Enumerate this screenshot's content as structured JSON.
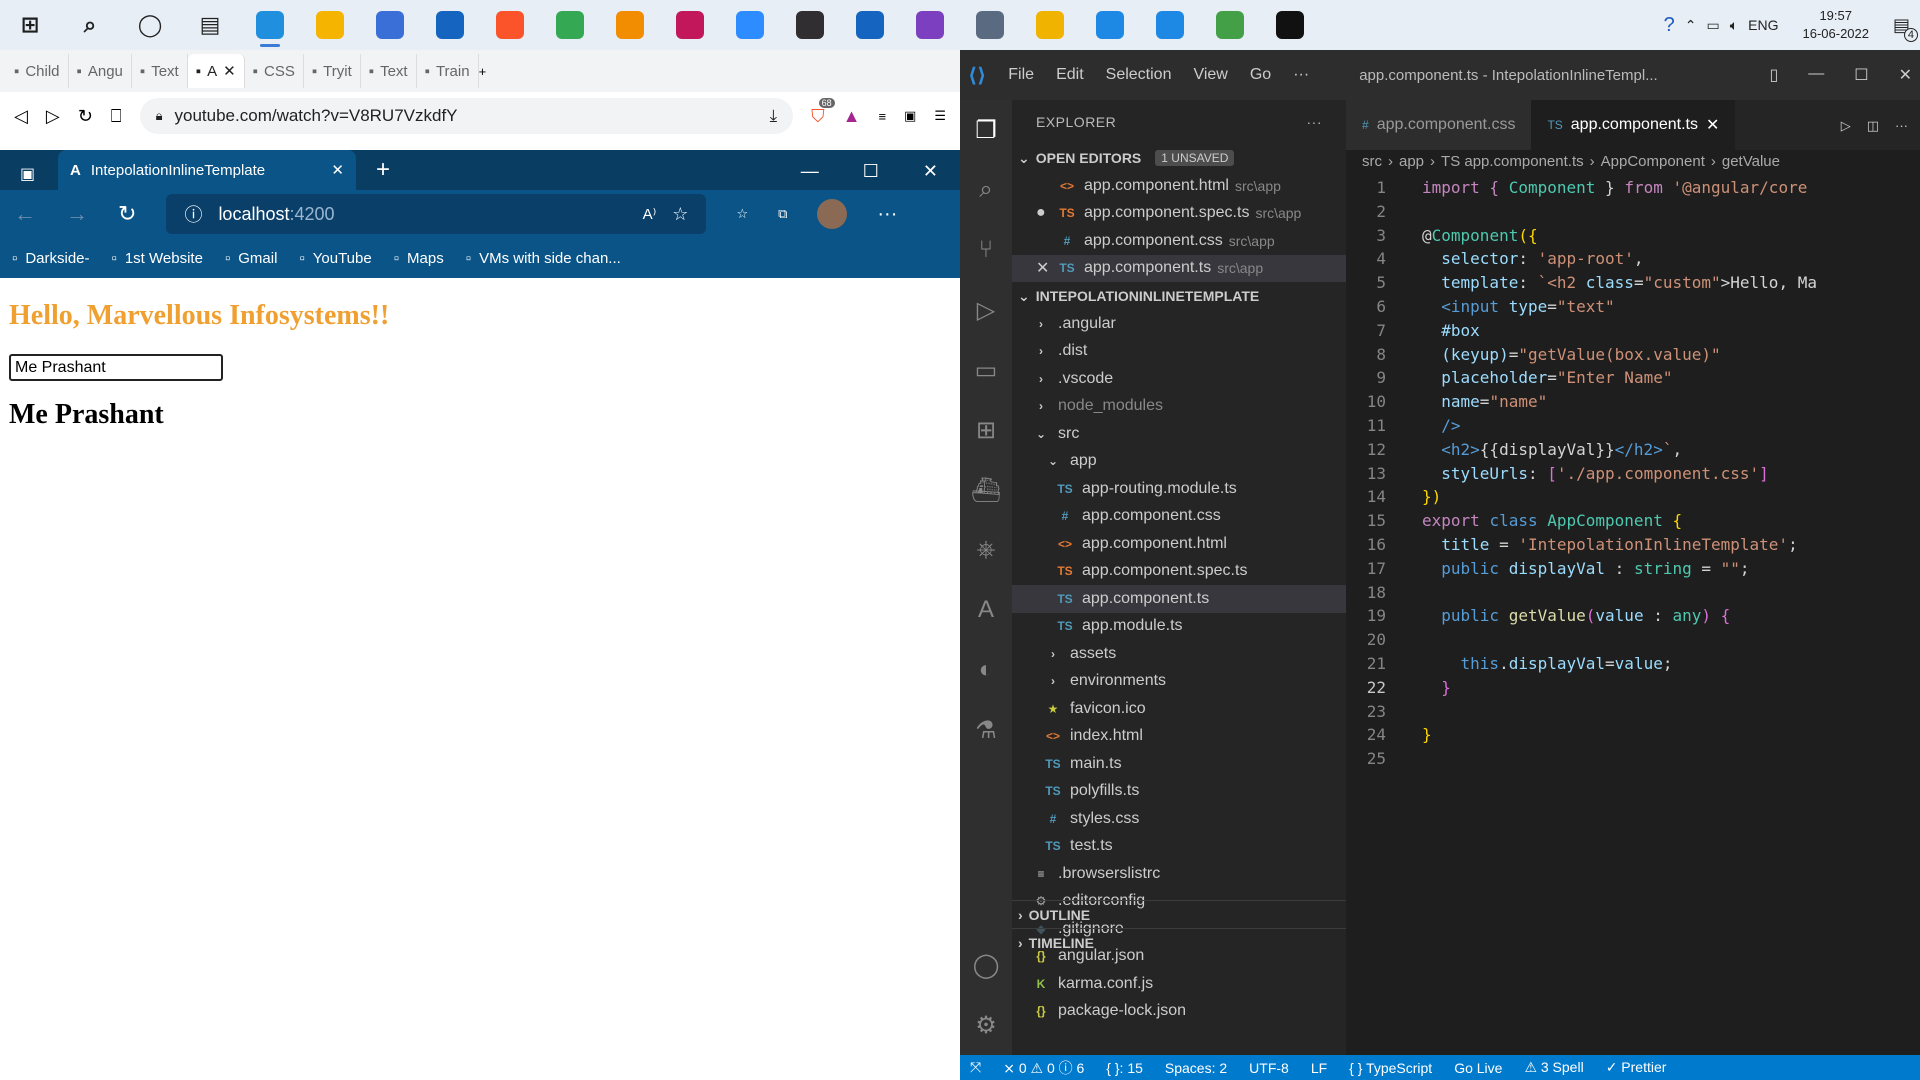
{
  "taskbar": {
    "apps": [
      {
        "name": "windows-start",
        "color": "#1e1e1e"
      },
      {
        "name": "search",
        "color": "#222"
      },
      {
        "name": "cortana",
        "color": "#222"
      },
      {
        "name": "task-view",
        "color": "#222"
      },
      {
        "name": "edge",
        "color": "#1f8fde"
      },
      {
        "name": "file-explorer",
        "color": "#f4b400"
      },
      {
        "name": "store",
        "color": "#3a6fd8"
      },
      {
        "name": "mail",
        "color": "#1565c0"
      },
      {
        "name": "brave",
        "color": "#fb542b"
      },
      {
        "name": "chrome",
        "color": "#34a853"
      },
      {
        "name": "vlc",
        "color": "#f28c00"
      },
      {
        "name": "intellij",
        "color": "#c2185b"
      },
      {
        "name": "zoom",
        "color": "#2d8cff"
      },
      {
        "name": "obs",
        "color": "#302e31"
      },
      {
        "name": "typora",
        "color": "#1565c0"
      },
      {
        "name": "visual-studio",
        "color": "#7b3fbf"
      },
      {
        "name": "settings-app",
        "color": "#5a6a80"
      },
      {
        "name": "sticky",
        "color": "#f0b400"
      },
      {
        "name": "vscode",
        "color": "#1e88e5"
      },
      {
        "name": "vscode-insiders",
        "color": "#1e88e5"
      },
      {
        "name": "atom",
        "color": "#43a047"
      },
      {
        "name": "terminal",
        "color": "#111"
      }
    ],
    "lang": "ENG",
    "time": "19:57",
    "date": "16-06-2022",
    "notif_count": "4"
  },
  "brave": {
    "tabs": [
      "Child",
      "Angu",
      "Text",
      "A",
      "CSS",
      "Tryit",
      "Text",
      "Train"
    ],
    "url": "youtube.com/watch?v=V8RU7VzkdfY",
    "badge": "68"
  },
  "edge": {
    "tab_title": "IntepolationInlineTemplate",
    "url_host": "localhost",
    "url_port": ":4200",
    "favorites": [
      "Darkside-",
      "1st Website",
      "Gmail",
      "YouTube",
      "Maps",
      "VMs with side chan..."
    ],
    "page": {
      "heading": "Hello, Marvellous Infosystems!!",
      "input_value": "Me Prashant",
      "output": "Me Prashant"
    }
  },
  "vscode": {
    "menu": [
      "File",
      "Edit",
      "Selection",
      "View",
      "Go",
      "···"
    ],
    "window_title": "app.component.ts - IntepolationInlineTempl...",
    "explorer_label": "EXPLORER",
    "open_editors_label": "OPEN EDITORS",
    "unsaved_badge": "1 UNSAVED",
    "open_editors": [
      {
        "icon": "<>",
        "icon_color": "#e37933",
        "name": "app.component.html",
        "path": "src\\app",
        "mark": ""
      },
      {
        "icon": "TS",
        "icon_color": "#e37933",
        "name": "app.component.spec.ts",
        "path": "src\\app",
        "mark": "●"
      },
      {
        "icon": "#",
        "icon_color": "#519aba",
        "name": "app.component.css",
        "path": "src\\app",
        "mark": ""
      },
      {
        "icon": "TS",
        "icon_color": "#519aba",
        "name": "app.component.ts",
        "path": "src\\app",
        "mark": "✕"
      }
    ],
    "project_label": "INTEPOLATIONINLINETEMPLATE",
    "tree": [
      {
        "d": 1,
        "icon": "›",
        "color": "#ccc",
        "name": ".angular"
      },
      {
        "d": 1,
        "icon": "›",
        "color": "#ccc",
        "name": ".dist"
      },
      {
        "d": 1,
        "icon": "›",
        "color": "#ccc",
        "name": ".vscode"
      },
      {
        "d": 1,
        "icon": "›",
        "color": "#ccc",
        "name": "node_modules",
        "dim": true
      },
      {
        "d": 1,
        "icon": "⌄",
        "color": "#ccc",
        "name": "src"
      },
      {
        "d": 2,
        "icon": "⌄",
        "color": "#ccc",
        "name": "app"
      },
      {
        "d": 3,
        "icon": "TS",
        "color": "#519aba",
        "name": "app-routing.module.ts"
      },
      {
        "d": 3,
        "icon": "#",
        "color": "#519aba",
        "name": "app.component.css"
      },
      {
        "d": 3,
        "icon": "<>",
        "color": "#e37933",
        "name": "app.component.html"
      },
      {
        "d": 3,
        "icon": "TS",
        "color": "#e37933",
        "name": "app.component.spec.ts"
      },
      {
        "d": 3,
        "icon": "TS",
        "color": "#519aba",
        "name": "app.component.ts",
        "sel": true
      },
      {
        "d": 3,
        "icon": "TS",
        "color": "#519aba",
        "name": "app.module.ts"
      },
      {
        "d": 2,
        "icon": "›",
        "color": "#ccc",
        "name": "assets"
      },
      {
        "d": 2,
        "icon": "›",
        "color": "#ccc",
        "name": "environments"
      },
      {
        "d": 2,
        "icon": "★",
        "color": "#cbcb41",
        "name": "favicon.ico"
      },
      {
        "d": 2,
        "icon": "<>",
        "color": "#e37933",
        "name": "index.html"
      },
      {
        "d": 2,
        "icon": "TS",
        "color": "#519aba",
        "name": "main.ts"
      },
      {
        "d": 2,
        "icon": "TS",
        "color": "#519aba",
        "name": "polyfills.ts"
      },
      {
        "d": 2,
        "icon": "#",
        "color": "#519aba",
        "name": "styles.css"
      },
      {
        "d": 2,
        "icon": "TS",
        "color": "#519aba",
        "name": "test.ts"
      },
      {
        "d": 1,
        "icon": "≡",
        "color": "#ccc",
        "name": ".browserslistrc"
      },
      {
        "d": 1,
        "icon": "⚙",
        "color": "#aaa",
        "name": ".editorconfig"
      },
      {
        "d": 1,
        "icon": "◆",
        "color": "#41535b",
        "name": ".gitignore"
      },
      {
        "d": 1,
        "icon": "{}",
        "color": "#cbcb41",
        "name": "angular.json"
      },
      {
        "d": 1,
        "icon": "K",
        "color": "#8dc149",
        "name": "karma.conf.js"
      },
      {
        "d": 1,
        "icon": "{}",
        "color": "#cbcb41",
        "name": "package-lock.json"
      }
    ],
    "outline_label": "OUTLINE",
    "timeline_label": "TIMELINE",
    "tabs": [
      {
        "icon": "#",
        "name": "app.component.css",
        "active": false
      },
      {
        "icon": "TS",
        "name": "app.component.ts",
        "active": true
      }
    ],
    "breadcrumbs": [
      "src",
      "app",
      "TS app.component.ts",
      "AppComponent",
      "getValue"
    ],
    "code": [
      [
        [
          "import { ",
          "#c586c0"
        ],
        [
          "Component",
          "#4ec9b0"
        ],
        [
          " } ",
          "#d4d4d4"
        ],
        [
          "from",
          "#c586c0"
        ],
        [
          " '@angular/core",
          "#ce9178"
        ]
      ],
      [],
      [
        [
          "@",
          "#d4d4d4"
        ],
        [
          "Component",
          "#4ec9b0"
        ],
        [
          "({",
          "#ffd700"
        ]
      ],
      [
        [
          "  selector",
          "#9cdcfe"
        ],
        [
          ": ",
          "#d4d4d4"
        ],
        [
          "'app-root'",
          "#ce9178"
        ],
        [
          ",",
          "#d4d4d4"
        ]
      ],
      [
        [
          "  template",
          "#9cdcfe"
        ],
        [
          ": ",
          "#d4d4d4"
        ],
        [
          "`<h2 ",
          "#ce9178"
        ],
        [
          "class",
          "#9cdcfe"
        ],
        [
          "=",
          "#d4d4d4"
        ],
        [
          "\"custom\"",
          "#ce9178"
        ],
        [
          ">Hello, Ma",
          "#d4d4d4"
        ]
      ],
      [
        [
          "  <input ",
          "#569cd6"
        ],
        [
          "type",
          "#9cdcfe"
        ],
        [
          "=",
          "#d4d4d4"
        ],
        [
          "\"text\"",
          "#ce9178"
        ]
      ],
      [
        [
          "  #box",
          "#9cdcfe"
        ]
      ],
      [
        [
          "  (keyup)",
          "#9cdcfe"
        ],
        [
          "=",
          "#d4d4d4"
        ],
        [
          "\"getValue(box.value)\"",
          "#ce9178"
        ]
      ],
      [
        [
          "  placeholder",
          "#9cdcfe"
        ],
        [
          "=",
          "#d4d4d4"
        ],
        [
          "\"Enter Name\"",
          "#ce9178"
        ]
      ],
      [
        [
          "  name",
          "#9cdcfe"
        ],
        [
          "=",
          "#d4d4d4"
        ],
        [
          "\"name\"",
          "#ce9178"
        ]
      ],
      [
        [
          "  />",
          "#569cd6"
        ]
      ],
      [
        [
          "  <h2>",
          "#569cd6"
        ],
        [
          "{{displayVal}}",
          "#d4d4d4"
        ],
        [
          "</h2>",
          "#569cd6"
        ],
        [
          "`",
          "#ce9178"
        ],
        [
          ",",
          "#d4d4d4"
        ]
      ],
      [
        [
          "  styleUrls",
          "#9cdcfe"
        ],
        [
          ": ",
          "#d4d4d4"
        ],
        [
          "[",
          "#da70d6"
        ],
        [
          "'./app.component.css'",
          "#ce9178"
        ],
        [
          "]",
          "#da70d6"
        ]
      ],
      [
        [
          "})",
          "#ffd700"
        ]
      ],
      [
        [
          "export ",
          "#c586c0"
        ],
        [
          "class ",
          "#569cd6"
        ],
        [
          "AppComponent ",
          "#4ec9b0"
        ],
        [
          "{",
          "#ffd700"
        ]
      ],
      [
        [
          "  title",
          "#9cdcfe"
        ],
        [
          " = ",
          "#d4d4d4"
        ],
        [
          "'IntepolationInlineTemplate'",
          "#ce9178"
        ],
        [
          ";",
          "#d4d4d4"
        ]
      ],
      [
        [
          "  public ",
          "#569cd6"
        ],
        [
          "displayVal",
          "#9cdcfe"
        ],
        [
          " : ",
          "#d4d4d4"
        ],
        [
          "string",
          "#4ec9b0"
        ],
        [
          " = ",
          "#d4d4d4"
        ],
        [
          "\"\"",
          "#ce9178"
        ],
        [
          ";",
          "#d4d4d4"
        ]
      ],
      [],
      [
        [
          "  public ",
          "#569cd6"
        ],
        [
          "getValue",
          "#dcdcaa"
        ],
        [
          "(",
          "#da70d6"
        ],
        [
          "value",
          "#9cdcfe"
        ],
        [
          " : ",
          "#d4d4d4"
        ],
        [
          "any",
          "#4ec9b0"
        ],
        [
          ") ",
          "#da70d6"
        ],
        [
          "{",
          "#da70d6"
        ]
      ],
      [],
      [
        [
          "    this",
          "#569cd6"
        ],
        [
          ".",
          "#d4d4d4"
        ],
        [
          "displayVal",
          "#9cdcfe"
        ],
        [
          "=",
          "#d4d4d4"
        ],
        [
          "value",
          "#9cdcfe"
        ],
        [
          ";",
          "#d4d4d4"
        ]
      ],
      [
        [
          "  }",
          "#da70d6"
        ]
      ],
      [],
      [
        [
          "}",
          "#ffd700"
        ]
      ],
      []
    ],
    "current_line": 22,
    "status": [
      "⨯ 0 ⚠ 0 ⓘ 6",
      "{ }: 15",
      "Spaces: 2",
      "UTF-8",
      "LF",
      "{ } TypeScript",
      "Go Live",
      "⚠ 3 Spell",
      "✓ Prettier"
    ]
  }
}
